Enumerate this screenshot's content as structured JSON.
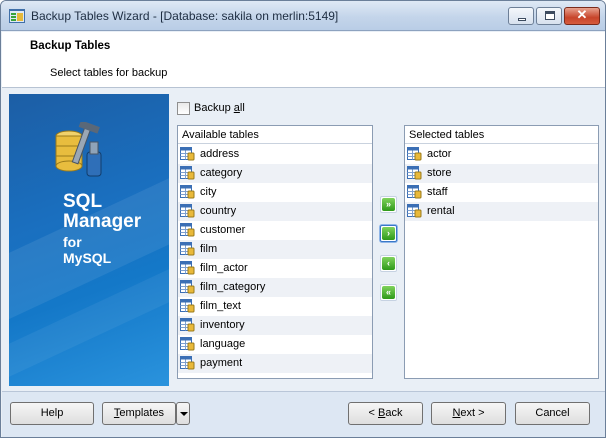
{
  "window": {
    "title": "Backup Tables Wizard - [Database: sakila on merlin:5149]",
    "close_glyph": "✕"
  },
  "header": {
    "title": "Backup Tables",
    "subtitle": "Select tables for backup"
  },
  "banner": {
    "line1": "SQL",
    "line2": "Manager",
    "line3": "for",
    "line4": "MySQL"
  },
  "backup_all": {
    "label_pre": "Backup ",
    "label_u": "a",
    "label_post": "ll",
    "checked": false
  },
  "available": {
    "header": "Available tables",
    "items": [
      "address",
      "category",
      "city",
      "country",
      "customer",
      "film",
      "film_actor",
      "film_category",
      "film_text",
      "inventory",
      "language",
      "payment"
    ]
  },
  "selected": {
    "header": "Selected tables",
    "items": [
      "actor",
      "store",
      "staff",
      "rental"
    ]
  },
  "transfer_buttons": {
    "add_all": "»",
    "add": "›",
    "remove": "‹",
    "remove_all": "«"
  },
  "footer": {
    "help": "Help",
    "templates_pre": "",
    "templates_u": "T",
    "templates_post": "emplates",
    "back_pre": "< ",
    "back_u": "B",
    "back_post": "ack",
    "next_pre": "",
    "next_u": "N",
    "next_post": "ext >",
    "cancel": "Cancel"
  },
  "icons": {
    "app": "database-wizard-icon",
    "table": "table-icon",
    "arrow": "green-arrow-icon"
  },
  "colors": {
    "banner": "#1a6fbf",
    "arrow_green": "#2f9a1a",
    "alt_row": "#eef1f6"
  }
}
